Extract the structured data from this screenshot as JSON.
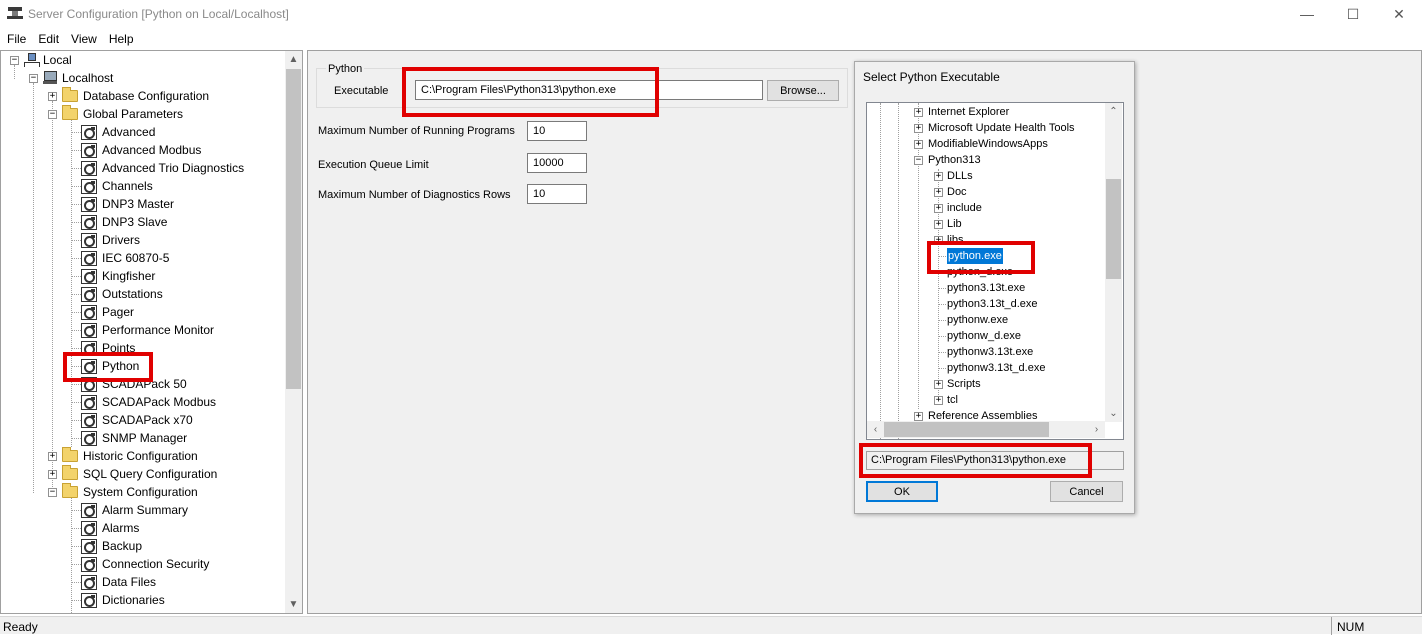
{
  "window": {
    "title": "Server Configuration [Python on Local/Localhost]",
    "minimize": "—",
    "maximize": "☐",
    "close": "✕"
  },
  "menu": [
    "File",
    "Edit",
    "View",
    "Help"
  ],
  "tree": {
    "root": "Local",
    "host": "Localhost",
    "database_config": "Database Configuration",
    "global_params": "Global Parameters",
    "global_items": [
      "Advanced",
      "Advanced Modbus",
      "Advanced Trio Diagnostics",
      "Channels",
      "DNP3 Master",
      "DNP3 Slave",
      "Drivers",
      "IEC 60870-5",
      "Kingfisher",
      "Outstations",
      "Pager",
      "Performance Monitor",
      "Points",
      "Python",
      "SCADAPack 50",
      "SCADAPack Modbus",
      "SCADAPack x70",
      "SNMP Manager"
    ],
    "historic": "Historic Configuration",
    "sql": "SQL Query Configuration",
    "system_config": "System Configuration",
    "system_items": [
      "Alarm Summary",
      "Alarms",
      "Backup",
      "Connection Security",
      "Data Files",
      "Dictionaries"
    ]
  },
  "python_panel": {
    "group_title": "Python",
    "executable_label": "Executable",
    "executable_value": "C:\\Program Files\\Python313\\python.exe",
    "browse_label": "Browse...",
    "max_programs_label": "Maximum Number of Running Programs",
    "max_programs_value": "10",
    "queue_limit_label": "Execution Queue Limit",
    "queue_limit_value": "10000",
    "diag_rows_label": "Maximum Number of Diagnostics Rows",
    "diag_rows_value": "10"
  },
  "dialog": {
    "title": "Select Python Executable",
    "folders_top": [
      "Internet Explorer",
      "Microsoft Update Health Tools",
      "ModifiableWindowsApps",
      "Python313"
    ],
    "python_children_folders": [
      "DLLs",
      "Doc",
      "include",
      "Lib",
      "libs"
    ],
    "files": [
      "python.exe",
      "python_d.exe",
      "python3.13t.exe",
      "python3.13t_d.exe",
      "pythonw.exe",
      "pythonw_d.exe",
      "pythonw3.13t.exe",
      "pythonw3.13t_d.exe"
    ],
    "after_folders": [
      "Scripts",
      "tcl"
    ],
    "last_folder": "Reference Assemblies",
    "selected_path": "C:\\Program Files\\Python313\\python.exe",
    "ok_label": "OK",
    "cancel_label": "Cancel"
  },
  "status": {
    "ready": "Ready",
    "num": "NUM"
  }
}
